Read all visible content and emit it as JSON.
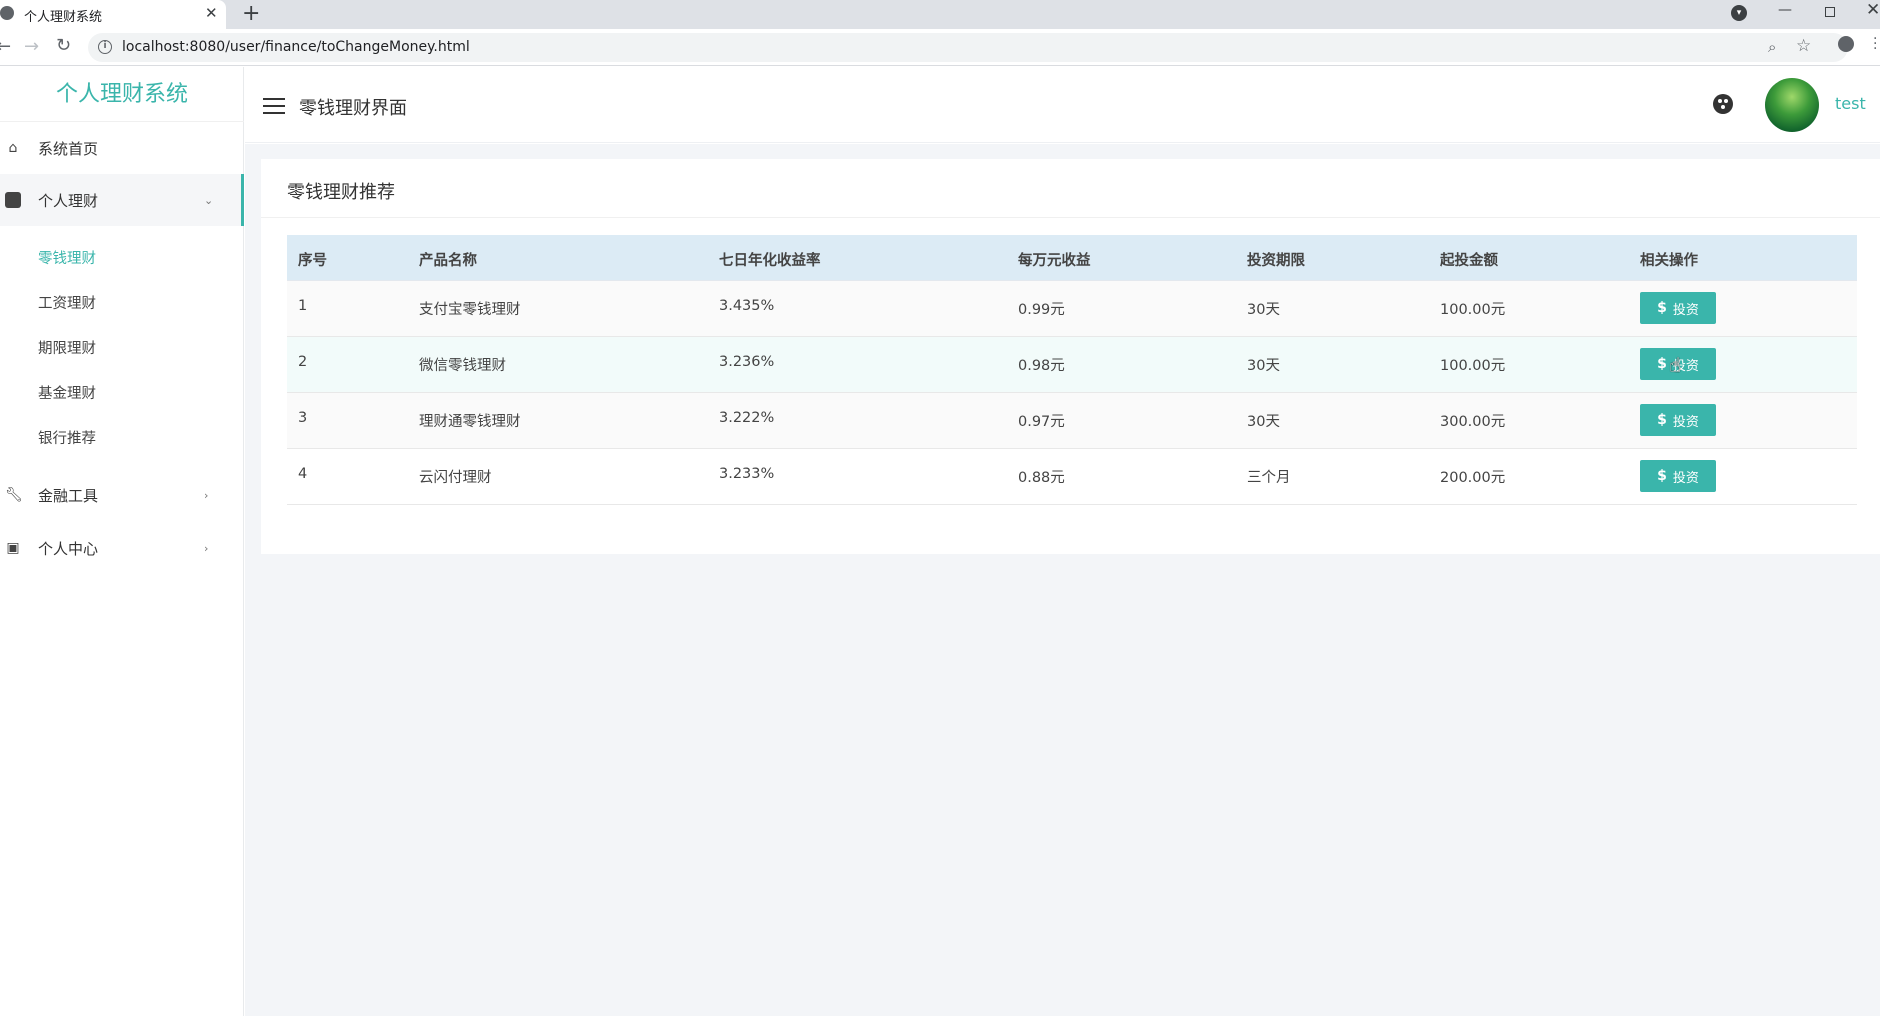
{
  "browser": {
    "tab_title": "个人理财系统",
    "tab_close": "✕",
    "new_tab": "+",
    "url": "localhost:8080/user/finance/toChangeMoney.html"
  },
  "sidebar": {
    "logo": "个人理财系统",
    "items": [
      {
        "label": "系统首页",
        "icon": "home-icon"
      },
      {
        "label": "个人理财",
        "icon": "dollar-icon",
        "expanded": true
      },
      {
        "label": "金融工具",
        "icon": "wrench-icon"
      },
      {
        "label": "个人中心",
        "icon": "user-card-icon"
      }
    ],
    "sub_items": [
      {
        "label": "零钱理财",
        "active": true
      },
      {
        "label": "工资理财"
      },
      {
        "label": "期限理财"
      },
      {
        "label": "基金理财"
      },
      {
        "label": "银行推荐"
      }
    ]
  },
  "header": {
    "title": "零钱理财界面",
    "username": "test"
  },
  "card": {
    "title": "零钱理财推荐"
  },
  "table": {
    "headers": [
      "序号",
      "产品名称",
      "七日年化收益率",
      "每万元收益",
      "投资期限",
      "起投金额",
      "相关操作"
    ],
    "rows": [
      {
        "no": "1",
        "name": "支付宝零钱理财",
        "rate": "3.435%",
        "per_10k": "0.99元",
        "term": "30天",
        "min_amount": "100.00元",
        "action": "投资"
      },
      {
        "no": "2",
        "name": "微信零钱理财",
        "rate": "3.236%",
        "per_10k": "0.98元",
        "term": "30天",
        "min_amount": "100.00元",
        "action": "投资"
      },
      {
        "no": "3",
        "name": "理财通零钱理财",
        "rate": "3.222%",
        "per_10k": "0.97元",
        "term": "30天",
        "min_amount": "300.00元",
        "action": "投资"
      },
      {
        "no": "4",
        "name": "云闪付理财",
        "rate": "3.233%",
        "per_10k": "0.88元",
        "term": "三个月",
        "min_amount": "200.00元",
        "action": "投资"
      }
    ]
  },
  "colors": {
    "accent": "#3ab5ab",
    "table_header_bg": "#dcebf5",
    "page_bg": "#f3f5f8"
  }
}
